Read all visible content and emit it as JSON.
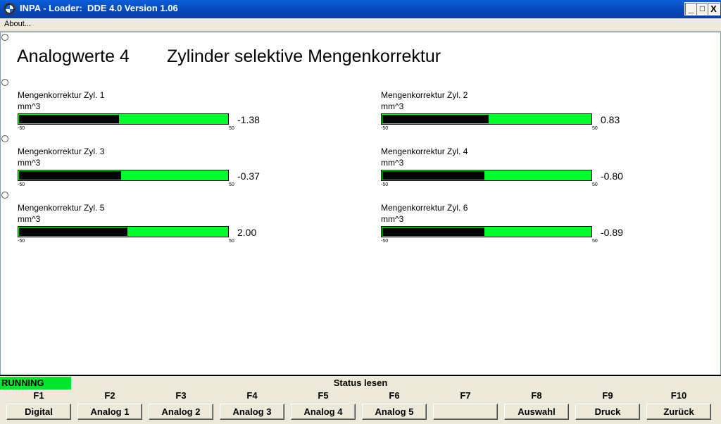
{
  "window": {
    "title": "INPA - Loader:  DDE 4.0 Version 1.06",
    "minimize": "_",
    "maximize": "□",
    "close": "X"
  },
  "menu": {
    "about": "About..."
  },
  "content": {
    "heading_left": "Analogwerte 4",
    "heading_right": "Zylinder selektive Mengenkorrektur",
    "meters": [
      {
        "label": "Mengenkorrektur Zyl. 1",
        "unit": "mm^3",
        "value": "-1.38",
        "min": "-50",
        "max": "50",
        "fill": 0.48
      },
      {
        "label": "Mengenkorrektur Zyl. 2",
        "unit": "mm^3",
        "value": "0.83",
        "min": "-50",
        "max": "50",
        "fill": 0.51
      },
      {
        "label": "Mengenkorrektur Zyl. 3",
        "unit": "mm^3",
        "value": "-0.37",
        "min": "-50",
        "max": "50",
        "fill": 0.49
      },
      {
        "label": "Mengenkorrektur Zyl. 4",
        "unit": "mm^3",
        "value": "-0.80",
        "min": "-50",
        "max": "50",
        "fill": 0.49
      },
      {
        "label": "Mengenkorrektur Zyl. 5",
        "unit": "mm^3",
        "value": "2.00",
        "min": "-50",
        "max": "50",
        "fill": 0.52
      },
      {
        "label": "Mengenkorrektur Zyl. 6",
        "unit": "mm^3",
        "value": "-0.89",
        "min": "-50",
        "max": "50",
        "fill": 0.49
      }
    ]
  },
  "statusbar": {
    "state": "RUNNING",
    "label": "Status lesen",
    "state_color": "#00e62a"
  },
  "function_keys": [
    {
      "key": "F1",
      "label": "Digital"
    },
    {
      "key": "F2",
      "label": "Analog 1"
    },
    {
      "key": "F3",
      "label": "Analog 2"
    },
    {
      "key": "F4",
      "label": "Analog 3"
    },
    {
      "key": "F5",
      "label": "Analog 4"
    },
    {
      "key": "F6",
      "label": "Analog 5"
    },
    {
      "key": "F7",
      "label": ""
    },
    {
      "key": "F8",
      "label": "Auswahl"
    },
    {
      "key": "F9",
      "label": "Druck"
    },
    {
      "key": "F10",
      "label": "Zurück"
    }
  ],
  "colors": {
    "bar_background": "#00ff2a",
    "bar_fill": "#000000",
    "titlebar": "#0846b8"
  }
}
